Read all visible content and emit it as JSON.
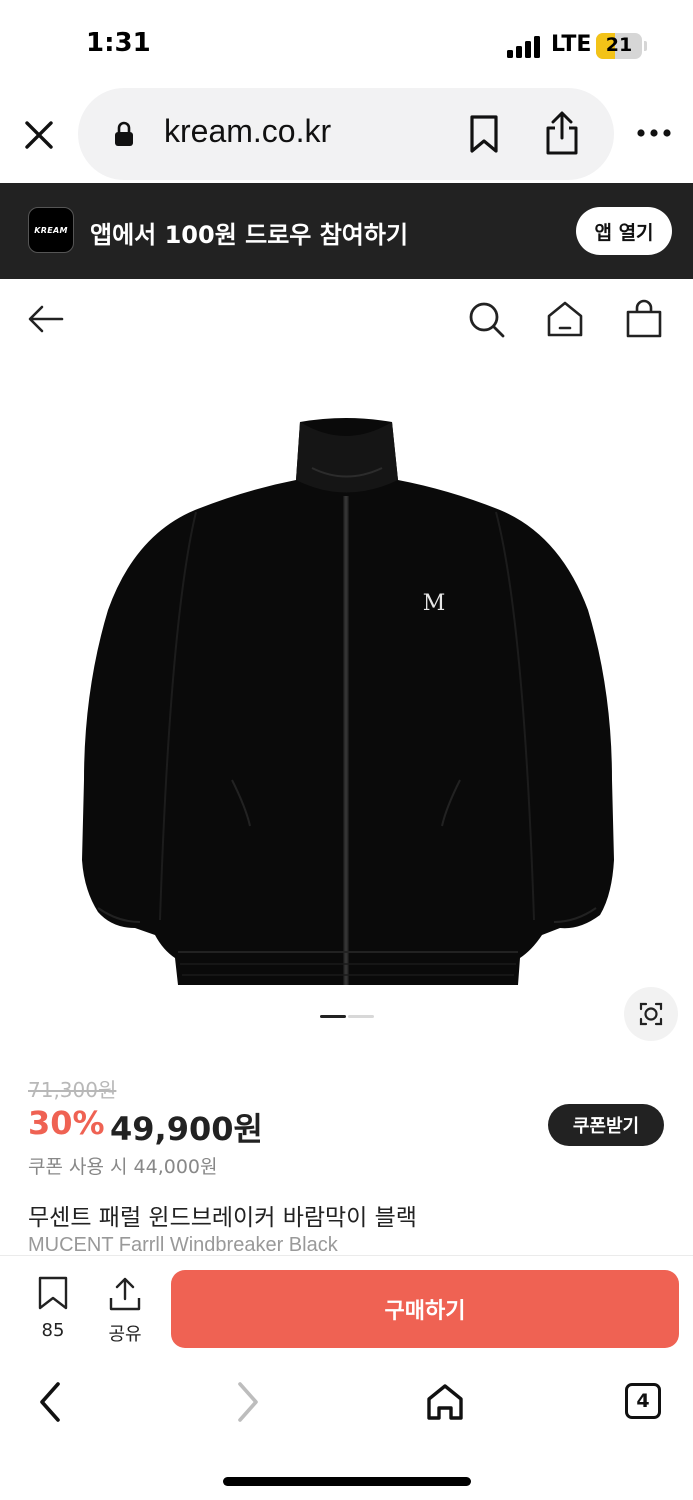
{
  "status_bar": {
    "time": "1:31",
    "network": "LTE",
    "battery_level": "21"
  },
  "browser": {
    "url": "kream.co.kr"
  },
  "app_banner": {
    "logo_text": "KREAM",
    "text": "앱에서 100원 드로우 참여하기",
    "open_label": "앱 열기"
  },
  "product": {
    "image_logo_text": "M",
    "image_page": {
      "current": 1,
      "total": 2
    },
    "original_price": "71,300원",
    "discount": "30%",
    "price": "49,900원",
    "coupon_label": "쿠폰받기",
    "coupon_price": "쿠폰 사용 시 44,000원",
    "name": "무센트 패럴 윈드브레이커 바람막이 블랙",
    "name_en": "MUCENT Farrll Windbreaker Black"
  },
  "action_bar": {
    "wish_count": "85",
    "share_label": "공유",
    "buy_label": "구매하기"
  },
  "browser_toolbar": {
    "tab_count": "4"
  },
  "colors": {
    "accent": "#ef6253",
    "banner_bg": "#222222",
    "dark_button": "#222222"
  }
}
